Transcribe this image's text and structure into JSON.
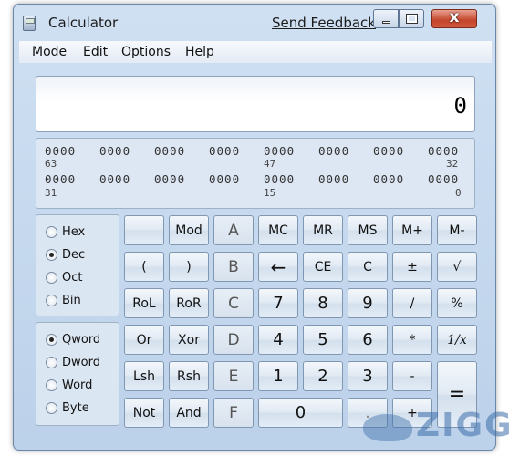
{
  "window": {
    "title": "Calculator",
    "feedback": "Send Feedback",
    "close_glyph": "x"
  },
  "menu": [
    "Mode",
    "Edit",
    "Options",
    "Help"
  ],
  "display": {
    "value": "0"
  },
  "bits": {
    "row1": [
      "0000",
      "0000",
      "0000",
      "0000",
      "0000",
      "0000",
      "0000",
      "0000"
    ],
    "row1_labels": {
      "left": "63",
      "mid": "47",
      "right": "32"
    },
    "row2": [
      "0000",
      "0000",
      "0000",
      "0000",
      "0000",
      "0000",
      "0000",
      "0000"
    ],
    "row2_labels": {
      "left": "31",
      "mid": "15",
      "right": "0"
    }
  },
  "base_options": [
    {
      "label": "Hex",
      "checked": false
    },
    {
      "label": "Dec",
      "checked": true
    },
    {
      "label": "Oct",
      "checked": false
    },
    {
      "label": "Bin",
      "checked": false
    }
  ],
  "word_options": [
    {
      "label": "Qword",
      "checked": true
    },
    {
      "label": "Dword",
      "checked": false
    },
    {
      "label": "Word",
      "checked": false
    },
    {
      "label": "Byte",
      "checked": false
    }
  ],
  "keys": {
    "blank": "",
    "mod": "Mod",
    "A": "A",
    "MC": "MC",
    "MR": "MR",
    "MS": "MS",
    "Mplus": "M+",
    "Mminus": "M-",
    "lparen": "(",
    "rparen": ")",
    "B": "B",
    "back": "←",
    "CE": "CE",
    "C": "C",
    "plusminus": "±",
    "sqrt": "√",
    "RoL": "RoL",
    "RoR": "RoR",
    "Chex": "C",
    "d7": "7",
    "d8": "8",
    "d9": "9",
    "div": "/",
    "pct": "%",
    "Or": "Or",
    "Xor": "Xor",
    "D": "D",
    "d4": "4",
    "d5": "5",
    "d6": "6",
    "mul": "*",
    "recip": "1/x",
    "Lsh": "Lsh",
    "Rsh": "Rsh",
    "E": "E",
    "d1": "1",
    "d2": "2",
    "d3": "3",
    "minus": "-",
    "equals": "=",
    "Not": "Not",
    "And": "And",
    "F": "F",
    "d0": "0",
    "dot": ".",
    "plus": "+"
  },
  "watermark": "ZIGG"
}
